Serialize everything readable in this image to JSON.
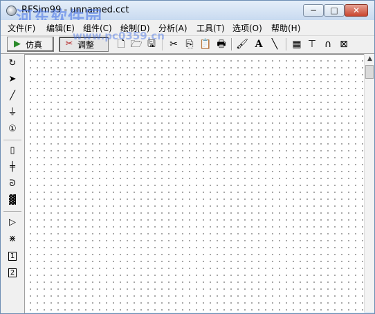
{
  "window": {
    "title": "RFSim99 - unnamed.cct",
    "watermark": "河东软件园",
    "watermark_url": "www.pc0359.cn",
    "min_glyph": "−",
    "max_glyph": "□",
    "close_glyph": "✕"
  },
  "menu": [
    "文件(F)",
    "编辑(E)",
    "组件(C)",
    "绘制(D)",
    "分析(A)",
    "工具(T)",
    "选项(O)",
    "帮助(H)"
  ],
  "toolbar": {
    "simulate_label": "仿真",
    "tune_label": "调整",
    "simulate_icon": "run-icon",
    "tune_icon": "tune-icon",
    "icons": [
      "new-icon",
      "open-icon",
      "save-icon",
      "cut-icon",
      "copy-icon",
      "paste-icon",
      "print-icon",
      "brush-icon",
      "text-icon",
      "pen-icon",
      "calculator-icon",
      "transmission-line-icon",
      "coupled-line-icon",
      "sparameter-icon"
    ]
  },
  "left_tools": [
    "rotate-icon",
    "pointer-icon",
    "wire-icon",
    "ground-icon",
    "port-icon",
    "resistor-icon",
    "capacitor-icon",
    "inductor-icon",
    "transformer-icon",
    "amplifier-icon",
    "crystal-icon",
    "one-port-icon",
    "two-port-icon"
  ],
  "left_text": {
    "one_port": "1",
    "two_port": "2",
    "port_mark": "1"
  }
}
